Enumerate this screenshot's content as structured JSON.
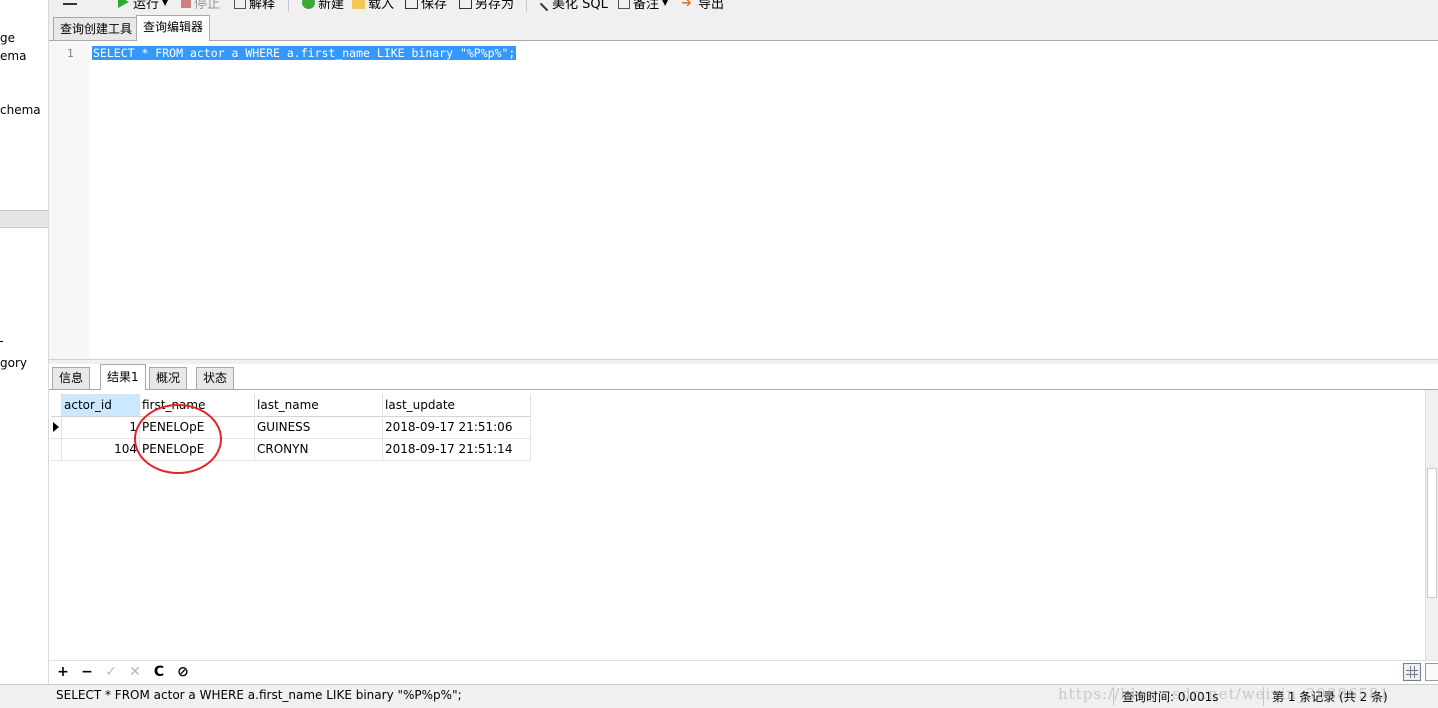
{
  "sidebar": {
    "items": [
      "ge",
      "ema",
      "chema",
      "",
      "gory"
    ]
  },
  "toolbar": {
    "run": "运行",
    "stop": "停止",
    "explain": "解释",
    "new": "新建",
    "load": "载入",
    "save": "保存",
    "save_as": "另存为",
    "beautify": "美化 SQL",
    "comment": "备注",
    "export": "导出"
  },
  "editor_tabs": [
    "查询创建工具",
    "查询编辑器"
  ],
  "editor": {
    "line_number": "1",
    "sql": "SELECT * FROM actor a WHERE a.first_name LIKE binary \"%P%p%\";"
  },
  "result_tabs": [
    "信息",
    "结果1",
    "概况",
    "状态"
  ],
  "grid": {
    "columns": [
      "actor_id",
      "first_name",
      "last_name",
      "last_update"
    ],
    "rows": [
      {
        "actor_id": "1",
        "first_name": "PENELOpE",
        "last_name": "GUINESS",
        "last_update": "2018-09-17 21:51:06"
      },
      {
        "actor_id": "104",
        "first_name": "PENELOpE",
        "last_name": "CRONYN",
        "last_update": "2018-09-17 21:51:14"
      }
    ]
  },
  "grid_toolbar": {
    "add": "+",
    "delete": "−",
    "apply": "✓",
    "discard": "✕",
    "refresh": "C",
    "stop": "⊘"
  },
  "status": {
    "sql": "SELECT * FROM actor a WHERE a.first_name LIKE binary \"%P%p%\";",
    "query_time": "查询时间: 0.001s",
    "records": "第 1 条记录 (共 2 条)",
    "watermark": "https://blog.csdn.net/weixin_39886581"
  },
  "colors": {
    "selection": "#3399ff",
    "highlight_circle": "#e0242a",
    "header_selected": "#cce8ff"
  }
}
